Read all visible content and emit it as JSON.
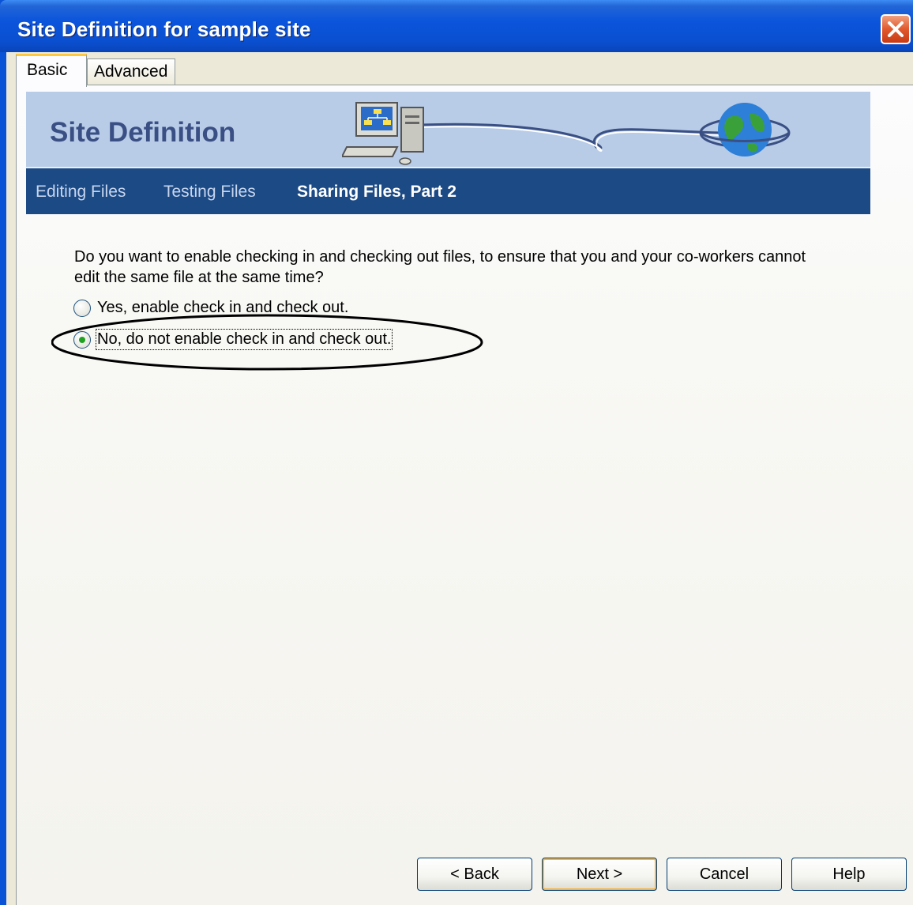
{
  "window": {
    "title": "Site Definition for sample site"
  },
  "tabs": [
    {
      "label": "Basic",
      "selected": true
    },
    {
      "label": "Advanced",
      "selected": false
    }
  ],
  "banner": {
    "title": "Site Definition",
    "icons": [
      "computer-icon",
      "globe-icon"
    ]
  },
  "steps": [
    {
      "label": "Editing Files",
      "active": false
    },
    {
      "label": "Testing Files",
      "active": false
    },
    {
      "label": "Sharing Files, Part 2",
      "active": true
    }
  ],
  "content": {
    "question": "Do you want to enable checking in and checking out files, to ensure that you and your co-workers cannot edit the same file at the same time?",
    "options": [
      {
        "label": "Yes, enable check in and check out.",
        "selected": false
      },
      {
        "label": "No, do not enable check in and check out.",
        "selected": true
      }
    ]
  },
  "buttons": {
    "back": "< Back",
    "next": "Next >",
    "cancel": "Cancel",
    "help": "Help"
  },
  "colors": {
    "titlebar": "#0a52d6",
    "banner": "#b8cce8",
    "navbar": "#1c4a85",
    "radio_selected": "#21a121"
  }
}
